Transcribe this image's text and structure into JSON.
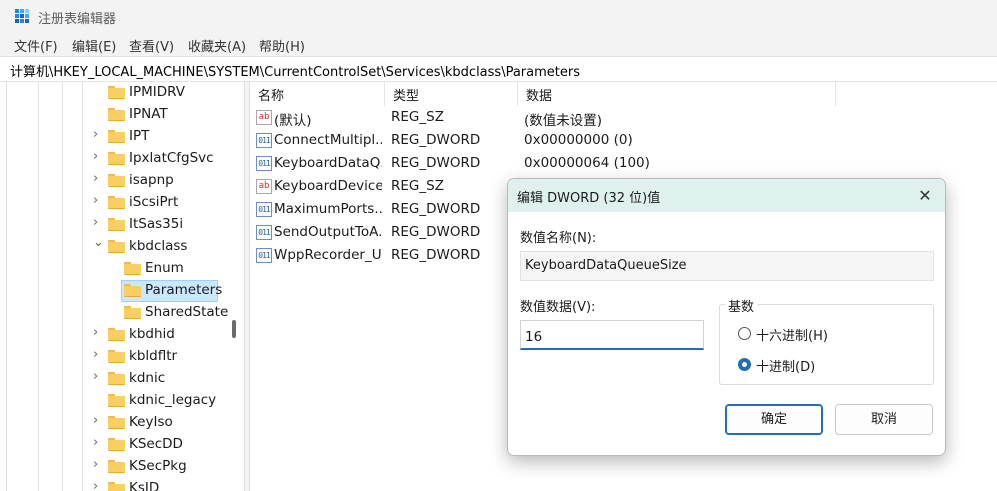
{
  "window": {
    "title": "注册表编辑器",
    "icon": "registry-editor-icon"
  },
  "menu": [
    {
      "label": "文件(F)"
    },
    {
      "label": "编辑(E)"
    },
    {
      "label": "查看(V)"
    },
    {
      "label": "收藏夹(A)"
    },
    {
      "label": "帮助(H)"
    }
  ],
  "address": "计算机\\HKEY_LOCAL_MACHINE\\SYSTEM\\CurrentControlSet\\Services\\kbdclass\\Parameters",
  "tree": {
    "items": [
      {
        "label": "IPMIDRV",
        "expander": "none",
        "level": 0
      },
      {
        "label": "IPNAT",
        "expander": "none",
        "level": 0
      },
      {
        "label": "IPT",
        "expander": "collapsed",
        "level": 0
      },
      {
        "label": "IpxlatCfgSvc",
        "expander": "collapsed",
        "level": 0
      },
      {
        "label": "isapnp",
        "expander": "collapsed",
        "level": 0
      },
      {
        "label": "iScsiPrt",
        "expander": "collapsed",
        "level": 0
      },
      {
        "label": "ItSas35i",
        "expander": "collapsed",
        "level": 0
      },
      {
        "label": "kbdclass",
        "expander": "expanded",
        "level": 0
      },
      {
        "label": "Enum",
        "expander": "none",
        "level": 1
      },
      {
        "label": "Parameters",
        "expander": "none",
        "level": 1,
        "selected": true
      },
      {
        "label": "SharedState",
        "expander": "none",
        "level": 1
      },
      {
        "label": "kbdhid",
        "expander": "collapsed",
        "level": 0
      },
      {
        "label": "kbldfltr",
        "expander": "collapsed",
        "level": 0
      },
      {
        "label": "kdnic",
        "expander": "collapsed",
        "level": 0
      },
      {
        "label": "kdnic_legacy",
        "expander": "none",
        "level": 0
      },
      {
        "label": "KeyIso",
        "expander": "collapsed",
        "level": 0
      },
      {
        "label": "KSecDD",
        "expander": "collapsed",
        "level": 0
      },
      {
        "label": "KSecPkg",
        "expander": "collapsed",
        "level": 0
      },
      {
        "label": "KsID",
        "expander": "collapsed",
        "level": 0
      }
    ]
  },
  "list": {
    "columns": {
      "name": "名称",
      "type": "类型",
      "data": "数据"
    },
    "rows": [
      {
        "icon": "string-value-icon",
        "name": "(默认)",
        "type": "REG_SZ",
        "data": "(数值未设置)"
      },
      {
        "icon": "dword-value-icon",
        "name": "ConnectMultipl...",
        "type": "REG_DWORD",
        "data": "0x00000000 (0)"
      },
      {
        "icon": "dword-value-icon",
        "name": "KeyboardDataQ...",
        "type": "REG_DWORD",
        "data": "0x00000064 (100)"
      },
      {
        "icon": "string-value-icon",
        "name": "KeyboardDevice...",
        "type": "REG_SZ",
        "data": ""
      },
      {
        "icon": "dword-value-icon",
        "name": "MaximumPorts...",
        "type": "REG_DWORD",
        "data": ""
      },
      {
        "icon": "dword-value-icon",
        "name": "SendOutputToA...",
        "type": "REG_DWORD",
        "data": ""
      },
      {
        "icon": "dword-value-icon",
        "name": "WppRecorder_U...",
        "type": "REG_DWORD",
        "data": ""
      }
    ]
  },
  "dialog": {
    "title": "编辑 DWORD (32 位)值",
    "name_label": "数值名称(N):",
    "name_value": "KeyboardDataQueueSize",
    "data_label": "数值数据(V):",
    "data_value": "16",
    "base_label": "基数",
    "hex_label": "十六进制(H)",
    "dec_label": "十进制(D)",
    "selected_base": "dec",
    "ok_label": "确定",
    "cancel_label": "取消",
    "close_glyph": "✕"
  },
  "colors": {
    "dialog_title_bg": "#dff1ee",
    "accent": "#1f6fb5",
    "selection": "#cce8ff"
  }
}
